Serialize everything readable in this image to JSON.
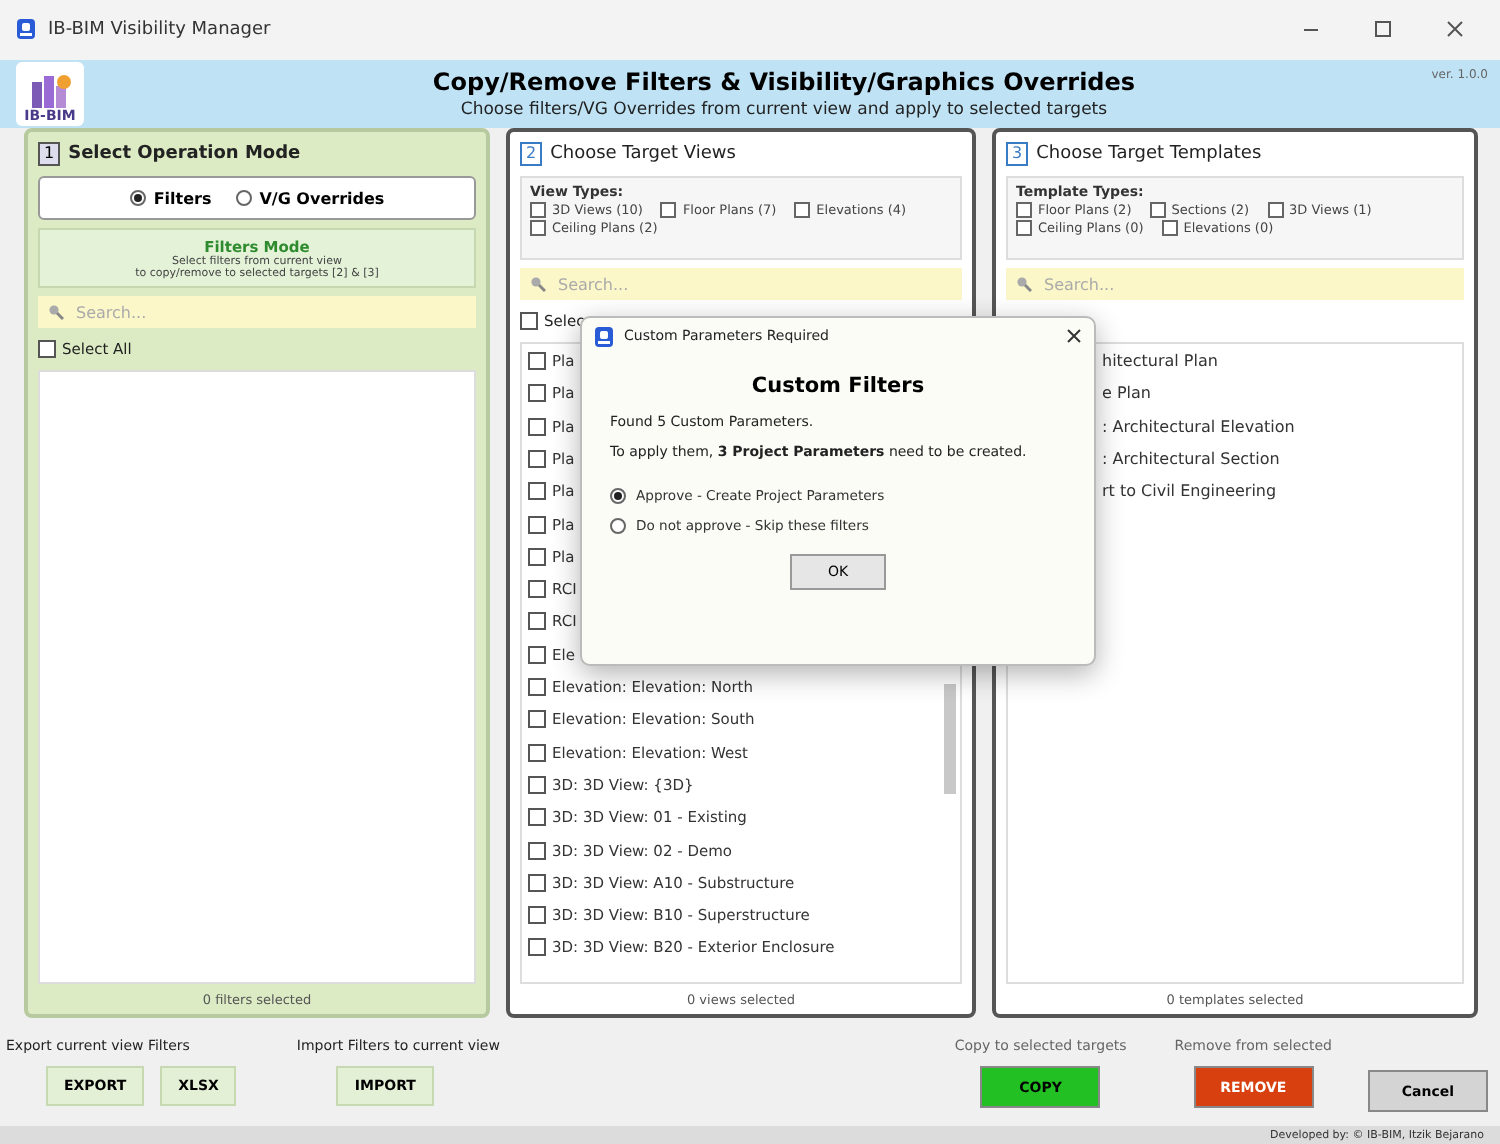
{
  "window": {
    "title": "IB-BIM Visibility Manager"
  },
  "header": {
    "logo_text": "IB-BIM",
    "title": "Copy/Remove Filters & Visibility/Graphics Overrides",
    "subtitle": "Choose filters/VG Overrides from current view and apply to selected targets",
    "version": "ver. 1.0.0"
  },
  "mode_panel": {
    "number": "1",
    "title": "Select Operation Mode",
    "modes": [
      {
        "label": "Filters",
        "selected": true
      },
      {
        "label": "V/G Overrides",
        "selected": false
      }
    ],
    "info_title": "Filters Mode",
    "info_lines": [
      "Select filters from current view",
      "to copy/remove to selected targets [2] & [3]"
    ],
    "search_placeholder": "Search...",
    "select_all": {
      "label": "Select All",
      "checked": false
    },
    "status": "0 filters selected"
  },
  "views_panel": {
    "number": "2",
    "title": "Choose Target Views",
    "types_title": "View Types:",
    "types": [
      {
        "label": "3D Views (10)",
        "checked": false
      },
      {
        "label": "Floor Plans (7)",
        "checked": false
      },
      {
        "label": "Elevations (4)",
        "checked": false
      },
      {
        "label": "Ceiling Plans (2)",
        "checked": false
      }
    ],
    "search_placeholder": "Search...",
    "select_all": {
      "label": "Selec",
      "checked": false
    },
    "items": [
      {
        "label": "Pla",
        "checked": false
      },
      {
        "label": "Pla",
        "checked": false
      },
      {
        "label": "Pla",
        "checked": false
      },
      {
        "label": "Pla",
        "checked": false
      },
      {
        "label": "Pla",
        "checked": false
      },
      {
        "label": "Pla",
        "checked": false
      },
      {
        "label": "Pla",
        "checked": false
      },
      {
        "label": "RCI",
        "checked": false
      },
      {
        "label": "RCI",
        "checked": false
      },
      {
        "label": "Ele",
        "checked": false
      },
      {
        "label": "Elevation: Elevation: North",
        "checked": false
      },
      {
        "label": "Elevation: Elevation: South",
        "checked": false
      },
      {
        "label": "Elevation: Elevation: West",
        "checked": false
      },
      {
        "label": "3D: 3D View: {3D}",
        "checked": false
      },
      {
        "label": "3D: 3D View: 01 - Existing",
        "checked": false
      },
      {
        "label": "3D: 3D View: 02 - Demo",
        "checked": false
      },
      {
        "label": "3D: 3D View: A10 - Substructure",
        "checked": false
      },
      {
        "label": "3D: 3D View: B10 - Superstructure",
        "checked": false
      },
      {
        "label": "3D: 3D View: B20 - Exterior Enclosure",
        "checked": false
      }
    ],
    "status": "0 views selected"
  },
  "templates_panel": {
    "number": "3",
    "title": "Choose Target Templates",
    "types_title": "Template Types:",
    "types": [
      {
        "label": "Floor Plans (2)",
        "checked": false
      },
      {
        "label": "Sections (2)",
        "checked": false
      },
      {
        "label": "3D Views (1)",
        "checked": false
      },
      {
        "label": "Ceiling Plans (0)",
        "checked": false
      },
      {
        "label": "Elevations (0)",
        "checked": false
      }
    ],
    "search_placeholder": "Search...",
    "items": [
      "hitectural Plan",
      "e Plan",
      ": Architectural Elevation",
      ": Architectural Section",
      "rt to Civil Engineering"
    ],
    "status": "0 templates selected"
  },
  "bottom": {
    "export_label": "Export current view Filters",
    "import_label": "Import Filters to current view",
    "export_buttons": [
      "EXPORT",
      "XLSX"
    ],
    "import_button": "IMPORT",
    "copy_label": "Copy to selected targets",
    "copy_button": "COPY",
    "remove_label": "Remove from selected",
    "remove_button": "REMOVE",
    "cancel_button": "Cancel"
  },
  "footer": "Developed by: © IB-BIM, Itzik Bejarano",
  "dialog": {
    "title": "Custom Parameters Required",
    "heading": "Custom Filters",
    "lines": [
      "Found 5 Custom Parameters.",
      "To apply them, **3 Project Parameters** need to be created."
    ],
    "options": [
      {
        "label": "Approve - Create Project Parameters",
        "selected": true
      },
      {
        "label": "Do not approve - Skip these filters",
        "selected": false
      }
    ],
    "ok_button": "OK"
  }
}
